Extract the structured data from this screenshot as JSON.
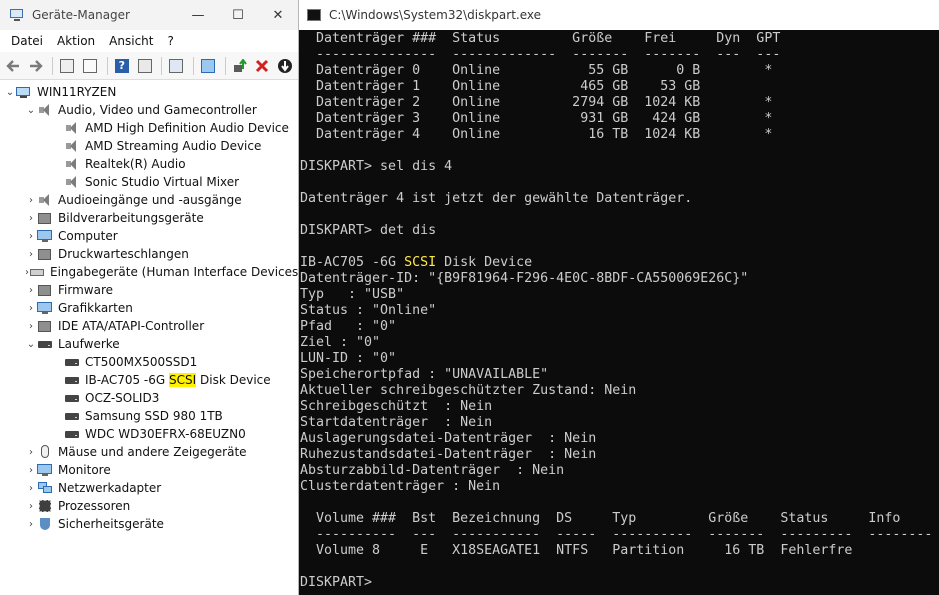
{
  "device_manager": {
    "title": "Geräte-Manager",
    "menu": [
      "Datei",
      "Aktion",
      "Ansicht",
      "?"
    ],
    "toolbar_icons": [
      "back-arrow-icon",
      "forward-arrow-icon",
      "show-hide-icon",
      "properties-icon",
      "help-icon",
      "resources-icon",
      "scan-hardware-icon",
      "monitor-icon",
      "update-driver-icon",
      "uninstall-icon",
      "download-icon"
    ],
    "tree": [
      {
        "level": 0,
        "expand": "v",
        "icon": "computer",
        "label": "WIN11RYZEN"
      },
      {
        "level": 1,
        "expand": "v",
        "icon": "speaker",
        "label": "Audio, Video und Gamecontroller"
      },
      {
        "level": 2,
        "expand": "",
        "icon": "speaker",
        "label": "AMD High Definition Audio Device"
      },
      {
        "level": 2,
        "expand": "",
        "icon": "speaker",
        "label": "AMD Streaming Audio Device"
      },
      {
        "level": 2,
        "expand": "",
        "icon": "speaker",
        "label": "Realtek(R) Audio"
      },
      {
        "level": 2,
        "expand": "",
        "icon": "speaker",
        "label": "Sonic Studio Virtual Mixer"
      },
      {
        "level": 1,
        "expand": ">",
        "icon": "speaker",
        "label": "Audioeingänge und -ausgänge"
      },
      {
        "level": 1,
        "expand": ">",
        "icon": "gray",
        "label": "Bildverarbeitungsgeräte"
      },
      {
        "level": 1,
        "expand": ">",
        "icon": "monitor",
        "label": "Computer"
      },
      {
        "level": 1,
        "expand": ">",
        "icon": "gray",
        "label": "Druckwarteschlangen"
      },
      {
        "level": 1,
        "expand": ">",
        "icon": "key",
        "label": "Eingabegeräte (Human Interface Devices)"
      },
      {
        "level": 1,
        "expand": ">",
        "icon": "gray",
        "label": "Firmware"
      },
      {
        "level": 1,
        "expand": ">",
        "icon": "monitor",
        "label": "Grafikkarten"
      },
      {
        "level": 1,
        "expand": ">",
        "icon": "gray",
        "label": "IDE ATA/ATAPI-Controller"
      },
      {
        "level": 1,
        "expand": "v",
        "icon": "drive",
        "label": "Laufwerke"
      },
      {
        "level": 2,
        "expand": "",
        "icon": "drive",
        "label": "CT500MX500SSD1"
      },
      {
        "level": 2,
        "expand": "",
        "icon": "drive",
        "label": "IB-AC705 -6G SCSI Disk Device",
        "label_pre": "IB-AC705 -6G",
        "label_hl": "SCSI",
        "label_post": " Disk Device"
      },
      {
        "level": 2,
        "expand": "",
        "icon": "drive",
        "label": "OCZ-SOLID3"
      },
      {
        "level": 2,
        "expand": "",
        "icon": "drive",
        "label": "Samsung SSD 980 1TB"
      },
      {
        "level": 2,
        "expand": "",
        "icon": "drive",
        "label": "WDC WD30EFRX-68EUZN0"
      },
      {
        "level": 1,
        "expand": ">",
        "icon": "mouse",
        "label": "Mäuse und andere Zeigegeräte"
      },
      {
        "level": 1,
        "expand": ">",
        "icon": "monitor",
        "label": "Monitore"
      },
      {
        "level": 1,
        "expand": ">",
        "icon": "net",
        "label": "Netzwerkadapter"
      },
      {
        "level": 1,
        "expand": ">",
        "icon": "cpu",
        "label": "Prozessoren"
      },
      {
        "level": 1,
        "expand": ">",
        "icon": "shield",
        "label": "Sicherheitsgeräte"
      }
    ]
  },
  "console": {
    "title": "C:\\Windows\\System32\\diskpart.exe",
    "lines": [
      {
        "text": "  Datenträger ###  Status         Größe    Frei     Dyn  GPT"
      },
      {
        "text": "  ---------------  -------------  -------  -------  ---  ---"
      },
      {
        "text": "  Datenträger 0    Online           55 GB      0 B        *"
      },
      {
        "text": "  Datenträger 1    Online          465 GB    53 GB"
      },
      {
        "text": "  Datenträger 2    Online         2794 GB  1024 KB        *"
      },
      {
        "text": "  Datenträger 3    Online          931 GB   424 GB        *"
      },
      {
        "text": "  Datenträger 4    Online           16 TB  1024 KB        *"
      },
      {
        "text": ""
      },
      {
        "text": "DISKPART> sel dis 4"
      },
      {
        "text": ""
      },
      {
        "text": "Datenträger 4 ist jetzt der gewählte Datenträger."
      },
      {
        "text": ""
      },
      {
        "text": "DISKPART> det dis"
      },
      {
        "text": ""
      },
      {
        "text": "IB-AC705 -6G SCSI Disk Device",
        "pre": "IB-AC705 -6G ",
        "hl": "SCSI",
        "post": " Disk Device"
      },
      {
        "text": "Datenträger-ID: \"{B9F81964-F296-4E0C-8BDF-CA550069E26C}\""
      },
      {
        "text": "Typ   : \"USB\""
      },
      {
        "text": "Status : \"Online\""
      },
      {
        "text": "Pfad   : \"0\""
      },
      {
        "text": "Ziel : \"0\""
      },
      {
        "text": "LUN-ID : \"0\""
      },
      {
        "text": "Speicherortpfad : \"UNAVAILABLE\""
      },
      {
        "text": "Aktueller schreibgeschützter Zustand: Nein"
      },
      {
        "text": "Schreibgeschützt  : Nein"
      },
      {
        "text": "Startdatenträger  : Nein"
      },
      {
        "text": "Auslagerungsdatei-Datenträger  : Nein"
      },
      {
        "text": "Ruhezustandsdatei-Datenträger  : Nein"
      },
      {
        "text": "Absturzabbild-Datenträger  : Nein"
      },
      {
        "text": "Clusterdatenträger : Nein"
      },
      {
        "text": ""
      },
      {
        "text": "  Volume ###  Bst  Bezeichnung  DS     Typ         Größe    Status     Info"
      },
      {
        "text": "  ----------  ---  -----------  -----  ----------  -------  ---------  --------"
      },
      {
        "text": "  Volume 8     E   X18SEAGATE1  NTFS   Partition     16 TB  Fehlerfre"
      },
      {
        "text": ""
      },
      {
        "text": "DISKPART> "
      }
    ]
  },
  "window_controls": {
    "minimize": "—",
    "maximize": "☐",
    "close": "✕"
  }
}
